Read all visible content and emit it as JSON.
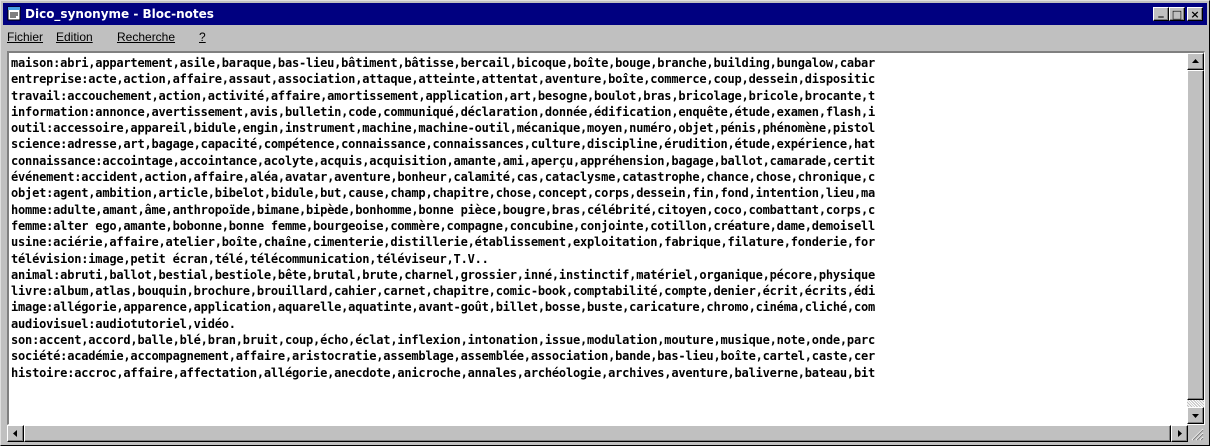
{
  "window": {
    "title": "Dico_synonyme - Bloc-notes",
    "controls": {
      "minimize": "_",
      "maximize": "□",
      "close": "×"
    }
  },
  "menu": [
    {
      "label": "Fichier"
    },
    {
      "label": "Edition"
    },
    {
      "label": "Recherche"
    },
    {
      "label": "?"
    }
  ],
  "lines": [
    "maison:abri,appartement,asile,baraque,bas-lieu,bâtiment,bâtisse,bercail,bicoque,boîte,bouge,branche,building,bungalow,cabar",
    "entreprise:acte,action,affaire,assaut,association,attaque,atteinte,attentat,aventure,boîte,commerce,coup,dessein,dispositic",
    "travail:accouchement,action,activité,affaire,amortissement,application,art,besogne,boulot,bras,bricolage,bricole,brocante,t",
    "information:annonce,avertissement,avis,bulletin,code,communiqué,déclaration,donnée,édification,enquête,étude,examen,flash,i",
    "outil:accessoire,appareil,bidule,engin,instrument,machine,machine-outil,mécanique,moyen,numéro,objet,pénis,phénomène,pistol",
    "science:adresse,art,bagage,capacité,compétence,connaissance,connaissances,culture,discipline,érudition,étude,expérience,hat",
    "connaissance:accointage,accointance,acolyte,acquis,acquisition,amante,ami,aperçu,appréhension,bagage,ballot,camarade,certit",
    "événement:accident,action,affaire,aléa,avatar,aventure,bonheur,calamité,cas,cataclysme,catastrophe,chance,chose,chronique,c",
    "objet:agent,ambition,article,bibelot,bidule,but,cause,champ,chapitre,chose,concept,corps,dessein,fin,fond,intention,lieu,ma",
    "homme:adulte,amant,âme,anthropoïde,bimane,bipède,bonhomme,bonne pièce,bougre,bras,célébrité,citoyen,coco,combattant,corps,c",
    "femme:alter ego,amante,bobonne,bonne femme,bourgeoise,commère,compagne,concubine,conjointe,cotillon,créature,dame,demoisell",
    "usine:aciérie,affaire,atelier,boîte,chaîne,cimenterie,distillerie,établissement,exploitation,fabrique,filature,fonderie,for",
    "télévision:image,petit écran,télé,télécommunication,téléviseur,T.V..",
    "animal:abruti,ballot,bestial,bestiole,bête,brutal,brute,charnel,grossier,inné,instinctif,matériel,organique,pécore,physique",
    "livre:album,atlas,bouquin,brochure,brouillard,cahier,carnet,chapitre,comic-book,comptabilité,compte,denier,écrit,écrits,édi",
    "image:allégorie,apparence,application,aquarelle,aquatinte,avant-goût,billet,bosse,buste,caricature,chromo,cinéma,cliché,com",
    "audiovisuel:audiotutoriel,vidéo.",
    "son:accent,accord,balle,blé,bran,bruit,coup,écho,éclat,inflexion,intonation,issue,modulation,mouture,musique,note,onde,parc",
    "société:académie,accompagnement,affaire,aristocratie,assemblage,assemblée,association,bande,bas-lieu,boîte,cartel,caste,cer",
    "histoire:accroc,affaire,affectation,allégorie,anecdote,anicroche,annales,archéologie,archives,aventure,baliverne,bateau,bit"
  ],
  "icons": {
    "app": "notepad-icon",
    "scroll_up": "arrow-up-icon",
    "scroll_down": "arrow-down-icon",
    "scroll_left": "arrow-left-icon",
    "scroll_right": "arrow-right-icon",
    "grip": "resize-grip-icon"
  },
  "colors": {
    "titlebar": "#000080",
    "face": "#c0c0c0",
    "text_bg": "#ffffff"
  }
}
